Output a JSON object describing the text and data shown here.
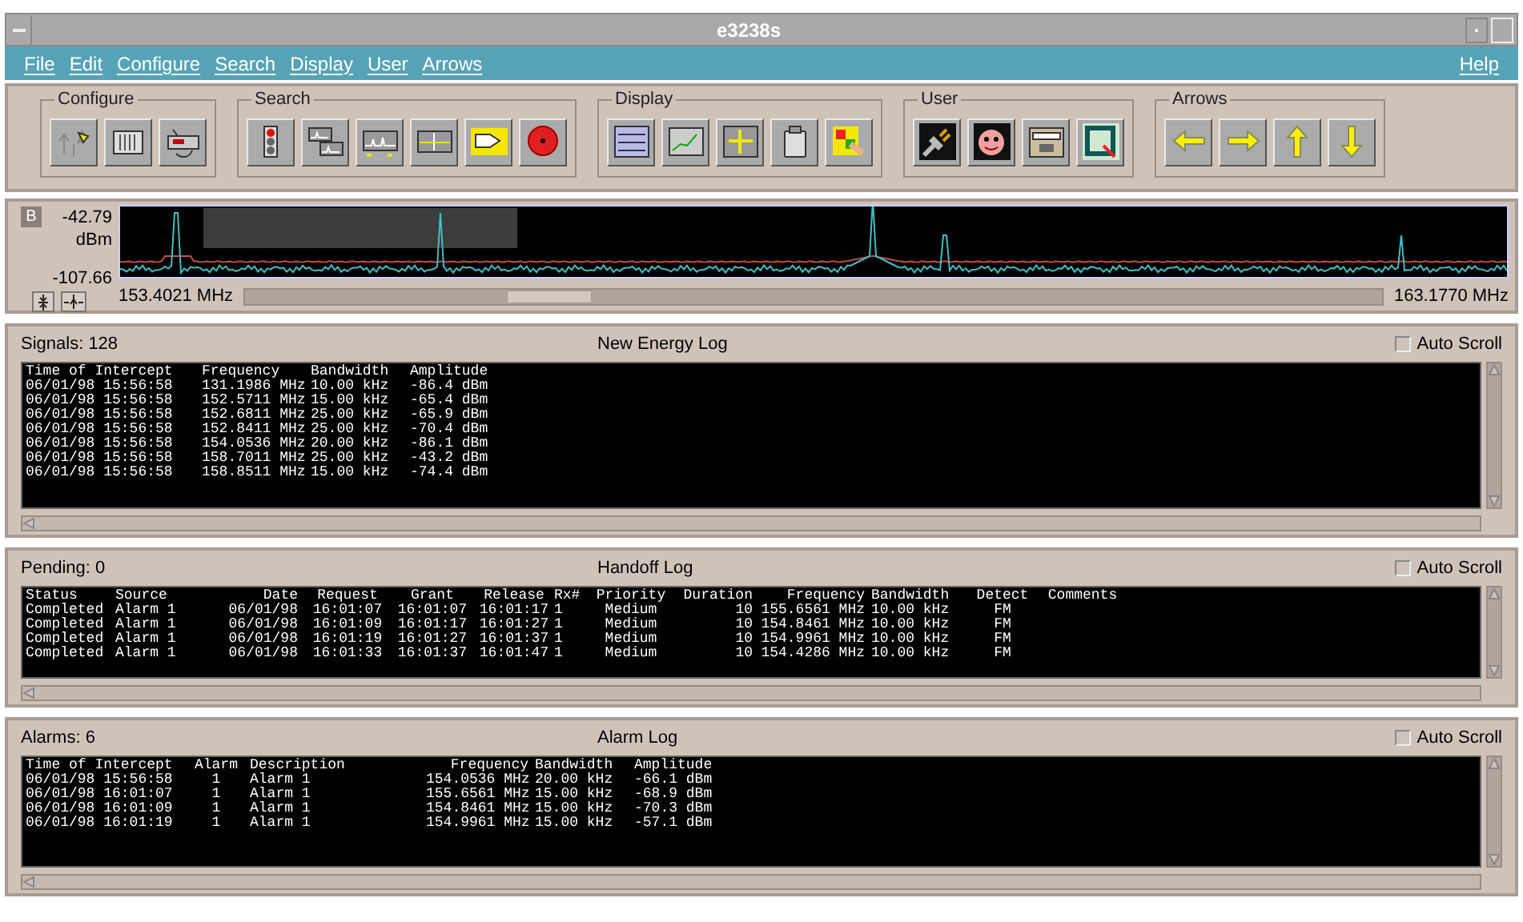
{
  "window": {
    "title": "e3238s"
  },
  "menu": [
    {
      "label": "File"
    },
    {
      "label": "Edit"
    },
    {
      "label": "Configure"
    },
    {
      "label": "Search"
    },
    {
      "label": "Display"
    },
    {
      "label": "User"
    },
    {
      "label": "Arrows"
    }
  ],
  "help_menu": {
    "label": "Help"
  },
  "toolbar_groups": [
    {
      "title": "Configure"
    },
    {
      "title": "Search"
    },
    {
      "title": "Display"
    },
    {
      "title": "User"
    },
    {
      "title": "Arrows"
    }
  ],
  "spectrum": {
    "badge": "B",
    "top_level": "-42.79",
    "unit": "dBm",
    "bottom_level": "-107.66",
    "start_freq": "153.4021 MHz",
    "stop_freq": "163.1770 MHz"
  },
  "logs": [
    {
      "kind": "energy",
      "count": "Signals: 128",
      "title": "New Energy Log",
      "auto_scroll": {
        "label": "Auto Scroll",
        "checked": false
      },
      "columns": [
        "Time of Intercept",
        "Frequency",
        "Bandwidth",
        "Amplitude"
      ],
      "rows": [
        [
          "06/01/98 15:56:58",
          "131.1986 MHz",
          "10.00 kHz",
          "-86.4 dBm"
        ],
        [
          "06/01/98 15:56:58",
          "152.5711 MHz",
          "15.00 kHz",
          "-65.4 dBm"
        ],
        [
          "06/01/98 15:56:58",
          "152.6811 MHz",
          "25.00 kHz",
          "-65.9 dBm"
        ],
        [
          "06/01/98 15:56:58",
          "152.8411 MHz",
          "25.00 kHz",
          "-70.4 dBm"
        ],
        [
          "06/01/98 15:56:58",
          "154.0536 MHz",
          "20.00 kHz",
          "-86.1 dBm"
        ],
        [
          "06/01/98 15:56:58",
          "158.7011 MHz",
          "25.00 kHz",
          "-43.2 dBm"
        ],
        [
          "06/01/98 15:56:58",
          "158.8511 MHz",
          "15.00 kHz",
          "-74.4 dBm"
        ]
      ]
    },
    {
      "kind": "handoff",
      "count": "Pending: 0",
      "title": "Handoff Log",
      "auto_scroll": {
        "label": "Auto Scroll",
        "checked": false
      },
      "columns": [
        "Status",
        "Source",
        "Date",
        "Request",
        "Grant",
        "Release",
        "Rx#",
        "Priority",
        "Duration",
        "Frequency",
        "Bandwidth",
        "Detect",
        "Comments"
      ],
      "rows": [
        [
          "Completed",
          "Alarm 1",
          "06/01/98",
          "16:01:07",
          "16:01:07",
          "16:01:17",
          "1",
          "Medium",
          "10",
          "155.6561 MHz",
          "10.00 kHz",
          "FM",
          ""
        ],
        [
          "Completed",
          "Alarm 1",
          "06/01/98",
          "16:01:09",
          "16:01:17",
          "16:01:27",
          "1",
          "Medium",
          "10",
          "154.8461 MHz",
          "10.00 kHz",
          "FM",
          ""
        ],
        [
          "Completed",
          "Alarm 1",
          "06/01/98",
          "16:01:19",
          "16:01:27",
          "16:01:37",
          "1",
          "Medium",
          "10",
          "154.9961 MHz",
          "10.00 kHz",
          "FM",
          ""
        ],
        [
          "Completed",
          "Alarm 1",
          "06/01/98",
          "16:01:33",
          "16:01:37",
          "16:01:47",
          "1",
          "Medium",
          "10",
          "154.4286 MHz",
          "10.00 kHz",
          "FM",
          ""
        ]
      ]
    },
    {
      "kind": "alarm",
      "count": "Alarms: 6",
      "title": "Alarm Log",
      "auto_scroll": {
        "label": "Auto Scroll",
        "checked": false
      },
      "columns": [
        "Time of Intercept",
        "Alarm",
        "Description",
        "Frequency",
        "Bandwidth",
        "Amplitude"
      ],
      "rows": [
        [
          "06/01/98 15:56:58",
          "1",
          "Alarm 1",
          "154.0536 MHz",
          "20.00 kHz",
          "-66.1 dBm"
        ],
        [
          "06/01/98 16:01:07",
          "1",
          "Alarm 1",
          "155.6561 MHz",
          "15.00 kHz",
          "-68.9 dBm"
        ],
        [
          "06/01/98 16:01:09",
          "1",
          "Alarm 1",
          "154.8461 MHz",
          "15.00 kHz",
          "-70.3 dBm"
        ],
        [
          "06/01/98 16:01:19",
          "1",
          "Alarm 1",
          "154.9961 MHz",
          "15.00 kHz",
          "-57.1 dBm"
        ]
      ]
    }
  ]
}
